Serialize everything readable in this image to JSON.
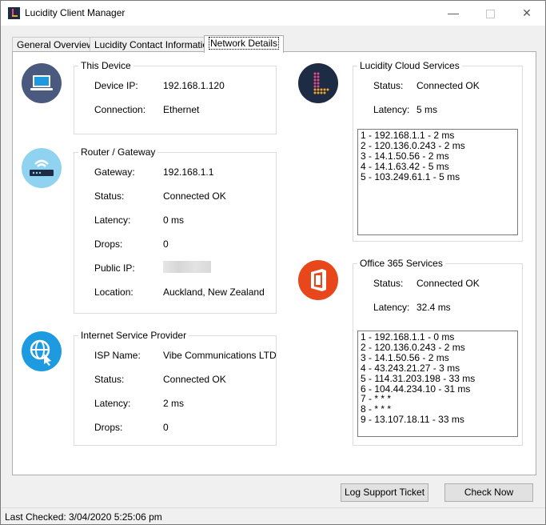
{
  "window": {
    "title": "Lucidity Client Manager"
  },
  "tabs": [
    {
      "label": "General Overview"
    },
    {
      "label": "Lucidity Contact Information"
    },
    {
      "label": "Network Details"
    }
  ],
  "this_device": {
    "title": "This Device",
    "rows": [
      {
        "label": "Device IP:",
        "value": "192.168.1.120"
      },
      {
        "label": "Connection:",
        "value": "Ethernet"
      }
    ]
  },
  "router": {
    "title": "Router / Gateway",
    "rows": [
      {
        "label": "Gateway:",
        "value": "192.168.1.1"
      },
      {
        "label": "Status:",
        "value": "Connected OK"
      },
      {
        "label": "Latency:",
        "value": "0 ms"
      },
      {
        "label": "Drops:",
        "value": "0"
      },
      {
        "label": "Public IP:",
        "value": ""
      },
      {
        "label": "Location:",
        "value": "Auckland, New Zealand"
      }
    ]
  },
  "isp": {
    "title": "Internet Service Provider",
    "rows": [
      {
        "label": "ISP Name:",
        "value": "Vibe Communications LTD"
      },
      {
        "label": "Status:",
        "value": "Connected OK"
      },
      {
        "label": "Latency:",
        "value": "2 ms"
      },
      {
        "label": "Drops:",
        "value": "0"
      }
    ]
  },
  "lucidity_cloud": {
    "title": "Lucidity Cloud Services",
    "rows": [
      {
        "label": "Status:",
        "value": "Connected OK"
      },
      {
        "label": "Latency:",
        "value": "5 ms"
      }
    ],
    "trace": [
      "1 - 192.168.1.1 - 2 ms",
      "2 - 120.136.0.243 - 2 ms",
      "3 - 14.1.50.56 - 2 ms",
      "4 - 14.1.63.42 - 5 ms",
      "5 - 103.249.61.1 - 5 ms"
    ]
  },
  "office365": {
    "title": "Office 365 Services",
    "rows": [
      {
        "label": "Status:",
        "value": "Connected OK"
      },
      {
        "label": "Latency:",
        "value": "32.4 ms"
      }
    ],
    "trace": [
      "1 - 192.168.1.1 - 0 ms",
      "2 - 120.136.0.243 - 2 ms",
      "3 - 14.1.50.56 - 2 ms",
      "4 - 43.243.21.27 - 3 ms",
      "5 - 114.31.203.198 - 33 ms",
      "6 - 104.44.234.10 - 31 ms",
      "7 -  *  *  *",
      "8 -  *  *  *",
      "9 - 13.107.18.11 - 33 ms"
    ]
  },
  "buttons": {
    "log_ticket": "Log Support Ticket",
    "check_now": "Check Now"
  },
  "status": {
    "label": "Last Checked:",
    "value": "3/04/2020 5:25:06 pm"
  },
  "icons": {
    "app": "lucidity-logo-icon",
    "device": "laptop-icon",
    "router": "wifi-router-icon",
    "isp": "globe-cursor-icon",
    "cloud": "lucidity-cloud-icon",
    "office": "office365-icon"
  },
  "colors": {
    "device_icon_bg": "#4a5a7e",
    "router_icon_bg": "#8fd3f0",
    "isp_icon_bg": "#1e9be0",
    "cloud_icon_bg": "#1d2b45",
    "office_icon_bg": "#e8471b"
  }
}
